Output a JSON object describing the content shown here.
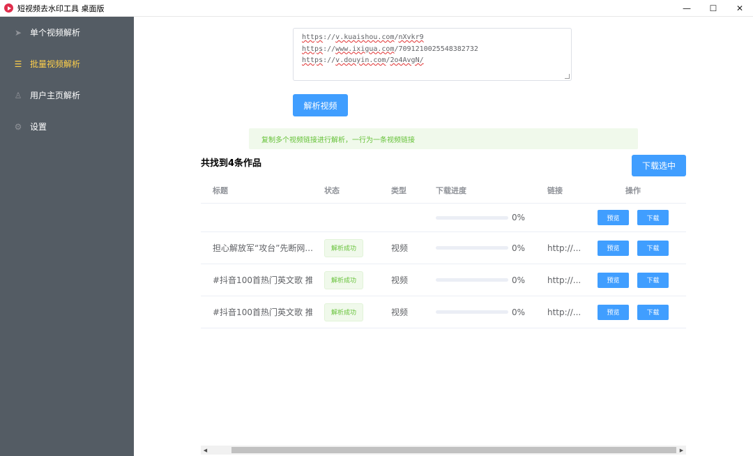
{
  "window": {
    "title": "短视频去水印工具 桌面版",
    "minimize": "—",
    "maximize": "☐",
    "close": "✕"
  },
  "sidebar": {
    "items": [
      {
        "label": "单个视频解析",
        "icon": "paper-plane-icon",
        "glyph": "➤",
        "active": false
      },
      {
        "label": "批量视频解析",
        "icon": "list-icon",
        "glyph": "☰",
        "active": true
      },
      {
        "label": "用户主页解析",
        "icon": "user-icon",
        "glyph": "♙",
        "active": false
      },
      {
        "label": "设置",
        "icon": "gear-icon",
        "glyph": "⚙",
        "active": false
      }
    ]
  },
  "input": {
    "lines": [
      {
        "prefix": "https",
        "sep1": "://",
        "host": "v.kuaishou.com",
        "sep2": "/",
        "path": "nXvkr9"
      },
      {
        "prefix": "https",
        "sep1": "://",
        "host": "www.ixigua.com",
        "sep2": "/",
        "path": "7091210025548382732"
      },
      {
        "prefix": "https",
        "sep1": "://",
        "host": "v.douyin.com",
        "sep2": "/",
        "path": "2o4AvgN/"
      }
    ]
  },
  "parse_button": "解析视频",
  "tip": "复制多个视频链接进行解析，一行为一条视频链接",
  "result_count": "共找到4条作品",
  "download_selected": "下载选中",
  "table": {
    "headers": {
      "title": "标题",
      "status": "状态",
      "type": "类型",
      "progress": "下载进度",
      "link": "链接",
      "ops": "操作"
    },
    "rows": [
      {
        "title": "",
        "status": "",
        "type": "",
        "progress": 0,
        "percent": "0%",
        "link": "",
        "preview": "预览",
        "download": "下载"
      },
      {
        "title": "担心解放军“攻台”先断网...",
        "status": "解析成功",
        "type": "视频",
        "progress": 0,
        "percent": "0%",
        "link": "http://...",
        "preview": "预览",
        "download": "下载"
      },
      {
        "title": "#抖音100首热门英文歌 推...",
        "status": "解析成功",
        "type": "视频",
        "progress": 0,
        "percent": "0%",
        "link": "http://...",
        "preview": "预览",
        "download": "下载"
      },
      {
        "title": "#抖音100首热门英文歌 推...",
        "status": "解析成功",
        "type": "视频",
        "progress": 0,
        "percent": "0%",
        "link": "http://...",
        "preview": "预览",
        "download": "下载"
      }
    ]
  },
  "scrollbar": {
    "left": "◀",
    "right": "▶"
  },
  "colors": {
    "sidebar_bg": "#545c64",
    "active_nav": "#ffd04b",
    "primary": "#409eff",
    "success": "#67c23a"
  }
}
